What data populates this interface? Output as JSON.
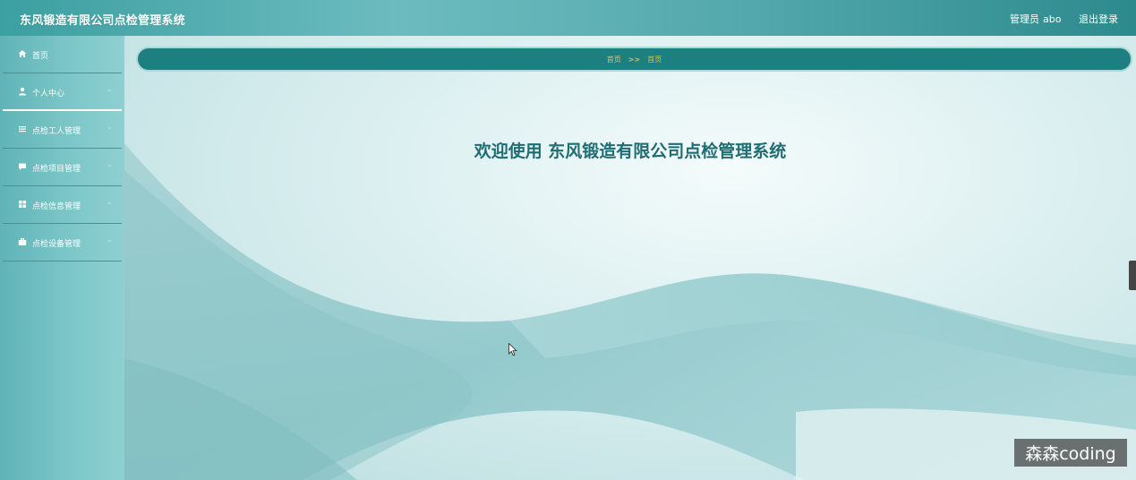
{
  "header": {
    "app_title": "东风锻造有限公司点检管理系统",
    "user_role": "管理员",
    "user_name": "abo",
    "logout_label": "退出登录"
  },
  "sidebar": {
    "items": [
      {
        "label": "首页",
        "icon": "home-icon"
      },
      {
        "label": "个人中心",
        "icon": "user-icon"
      },
      {
        "label": "点检工人管理",
        "icon": "list-icon"
      },
      {
        "label": "点检项目管理",
        "icon": "comment-icon"
      },
      {
        "label": "点检信息管理",
        "icon": "grid-icon"
      },
      {
        "label": "点检设备管理",
        "icon": "briefcase-icon"
      }
    ]
  },
  "breadcrumb": {
    "home": "首页",
    "separator": ">>",
    "current": "首页"
  },
  "main": {
    "welcome_text": "欢迎使用 东风锻造有限公司点检管理系统"
  },
  "watermark": "森森coding",
  "colors": {
    "accent": "#1d7f80",
    "breadcrumb_text": "#e2c12e",
    "welcome_text": "#1f6d72"
  }
}
